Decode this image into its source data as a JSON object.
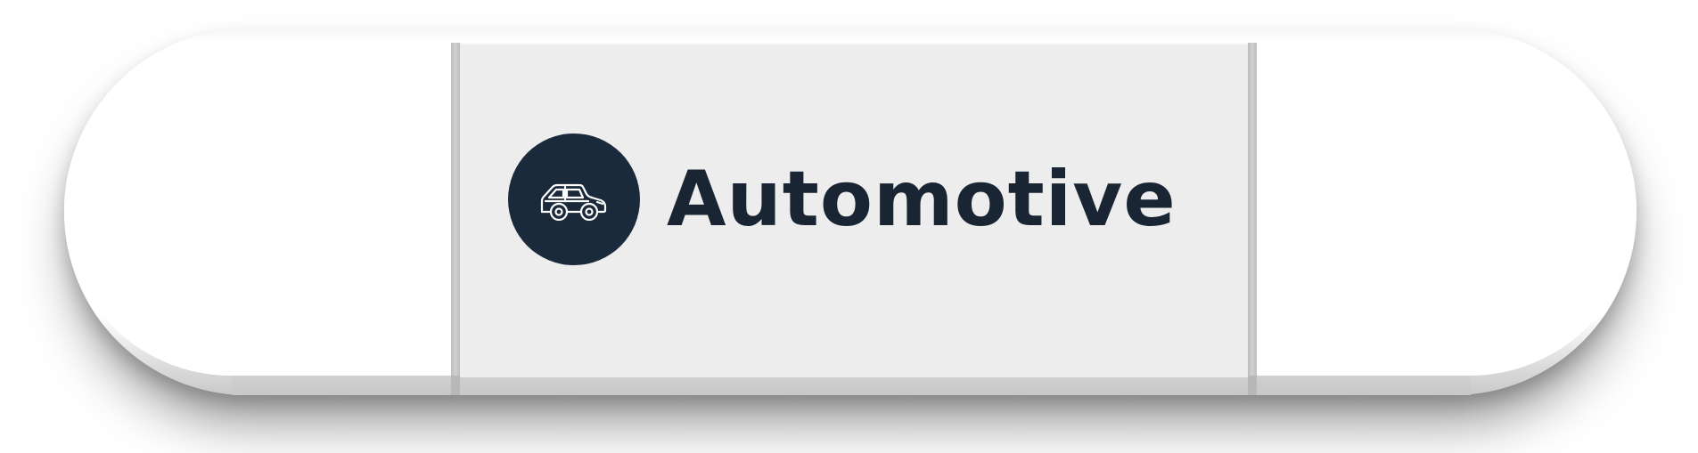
{
  "card": {
    "label": "Automotive",
    "icon": "car-icon",
    "colors": {
      "icon_background": "#1a2a3a",
      "icon_stroke": "#ffffff",
      "label_text": "#1a2533",
      "center_panel": "#ededed",
      "pill_background": "#ffffff"
    }
  }
}
